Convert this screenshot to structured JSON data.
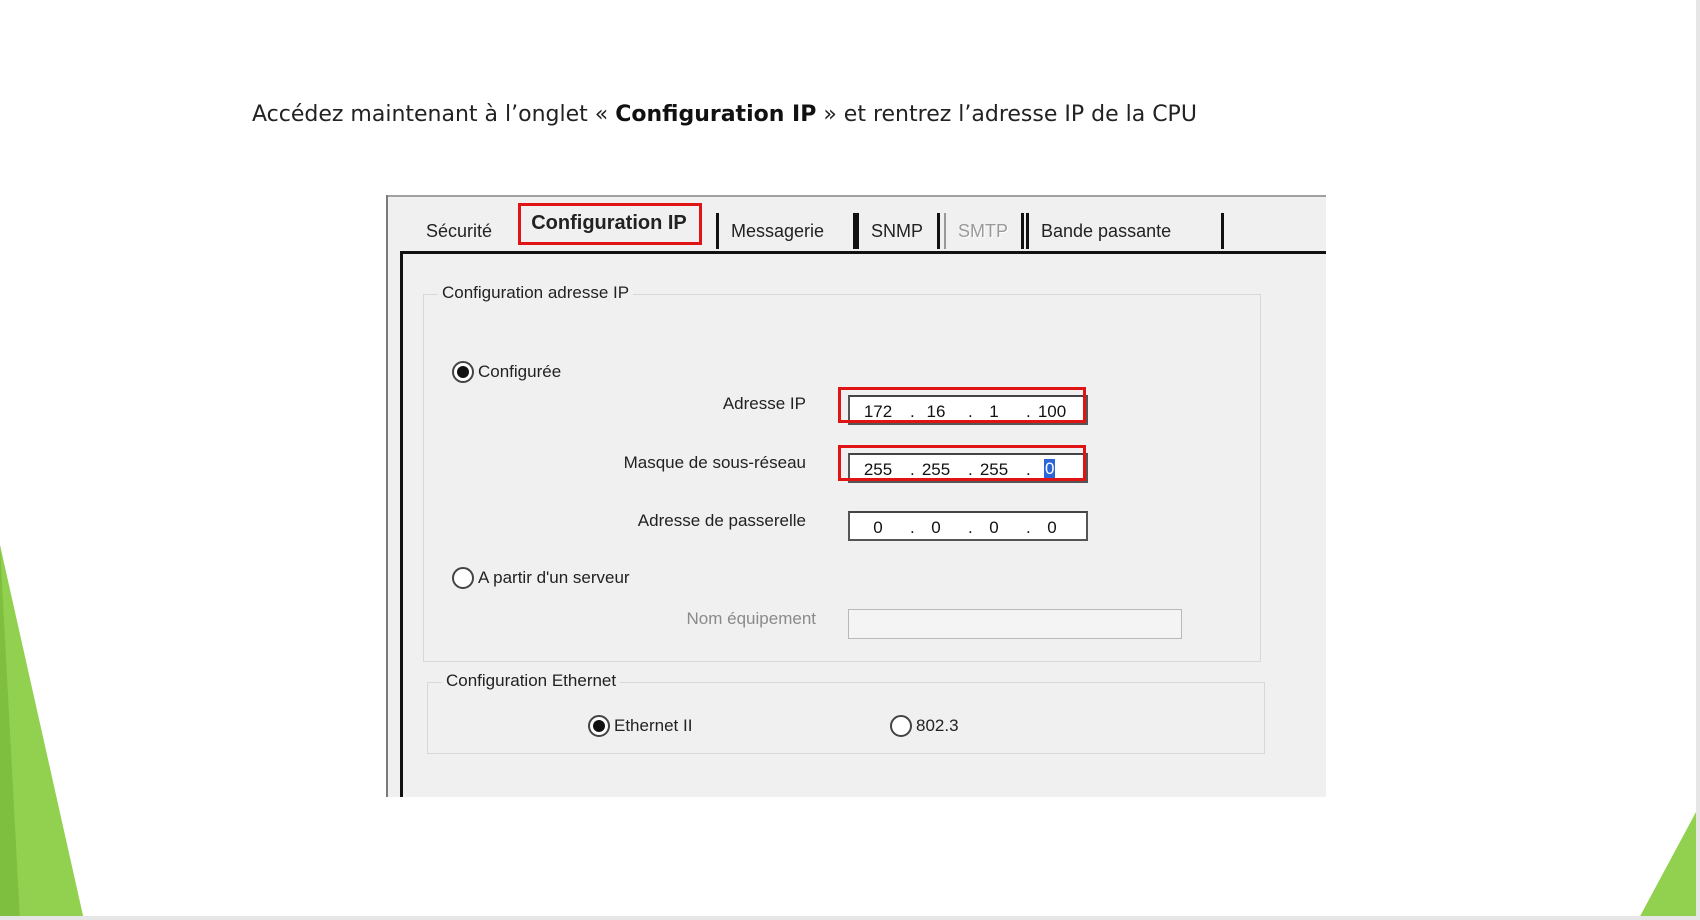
{
  "instruction": {
    "before": "Accédez maintenant à l’onglet « ",
    "bold": "Configuration IP",
    "after": " » et rentrez l’adresse IP de la CPU"
  },
  "tabs": [
    {
      "label": "Sécurité",
      "active": false,
      "enabled": true
    },
    {
      "label": "Configuration  IP",
      "active": true,
      "enabled": true
    },
    {
      "label": "Messagerie",
      "active": false,
      "enabled": true
    },
    {
      "label": "SNMP",
      "active": false,
      "enabled": true
    },
    {
      "label": "SMTP",
      "active": false,
      "enabled": false
    },
    {
      "label": "Bande passante",
      "active": false,
      "enabled": true
    }
  ],
  "ip_group": {
    "title": "Configuration adresse IP",
    "configured_radio": {
      "label": "Configurée",
      "checked": true
    },
    "ip_address": {
      "label": "Adresse IP",
      "octets": [
        "172",
        "16",
        "1",
        "100"
      ]
    },
    "subnet_mask": {
      "label": "Masque de sous-réseau",
      "octets": [
        "255",
        "255",
        "255",
        "0"
      ]
    },
    "gateway": {
      "label": "Adresse de passerelle",
      "octets": [
        "0",
        "0",
        "0",
        "0"
      ]
    },
    "server_radio": {
      "label": "A partir d'un serveur",
      "checked": false
    },
    "device_name": {
      "label": "Nom équipement",
      "value": ""
    }
  },
  "eth_group": {
    "title": "Configuration Ethernet",
    "ethernet2": {
      "label": "Ethernet II",
      "checked": true
    },
    "ieee8023": {
      "label": "802.3",
      "checked": false
    }
  },
  "colors": {
    "highlight": "#e01414",
    "accent_green": "#92d050",
    "selection": "#2a66d8"
  }
}
